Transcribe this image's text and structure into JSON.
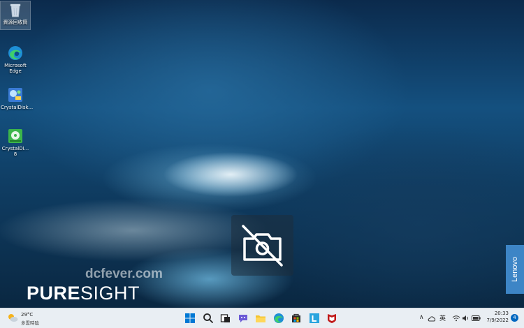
{
  "desktop_icons": [
    {
      "name": "recycle-bin-icon",
      "label": "資源回收筒"
    },
    {
      "name": "edge-icon",
      "label": "Microsoft Edge"
    },
    {
      "name": "crystaldiskinfo-icon",
      "label": "CrystalDisk..."
    },
    {
      "name": "crystaldiskmark-icon",
      "label": "CrystalDi... 8"
    }
  ],
  "overlay": {
    "icon": "camera-off-icon"
  },
  "watermark": "dcfever.com",
  "branding": {
    "pure": "PURE",
    "sight": "SIGHT",
    "vendor": "Lenovo"
  },
  "taskbar": {
    "weather": {
      "temp": "29°C",
      "desc": "多雲時陰"
    },
    "apps": [
      "windows-start-icon",
      "search-icon",
      "task-view-icon",
      "chat-icon",
      "file-explorer-icon",
      "edge-icon",
      "store-icon",
      "lenovo-l-icon",
      "mcafee-icon"
    ],
    "tray": {
      "ime": "英",
      "time": "20:33",
      "date": "7/9/2022",
      "notifications": "4"
    }
  },
  "colors": {
    "taskbar": "#e9eef3",
    "accent": "#0067c0",
    "lenovo": "#3d85c6"
  }
}
